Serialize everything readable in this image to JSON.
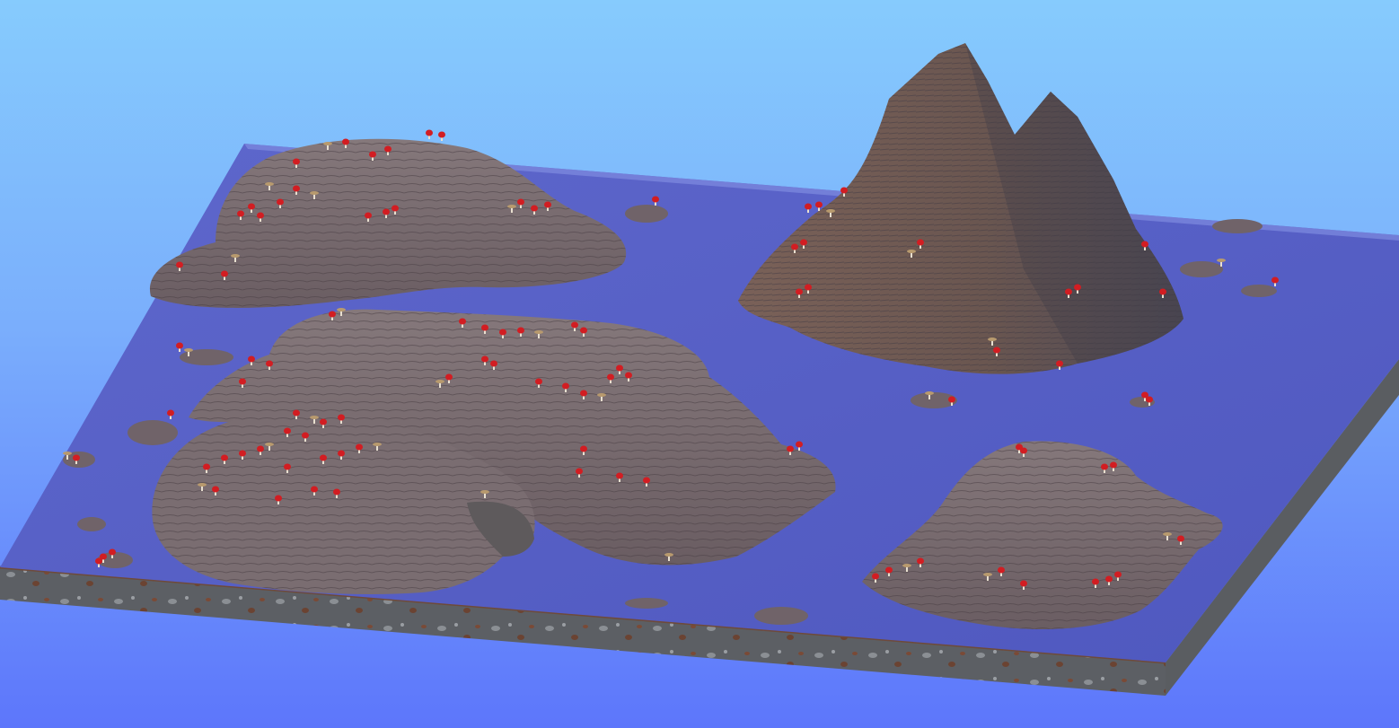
{
  "scene": {
    "kind": "voxel-world-render",
    "view": "isometric overview of a square voxel terrain slab",
    "colors": {
      "sky_top": "#86cbfd",
      "sky_bottom": "#5d76fb",
      "water": "#5a62c6",
      "water_edge": "#4a55b8",
      "land": "#7b6e72",
      "land_dark": "#5f5257",
      "mountain": "#6e5a55",
      "mountain_shadow": "#4f4a52",
      "slab_side": "#5b5f63",
      "slab_dirt": "#6a4a3a",
      "mushroom_red": "#d21d22",
      "mushroom_brown": "#b89a6e",
      "stem": "#e9e0d0"
    },
    "features": {
      "islands": 4,
      "mountain_peaks": 2,
      "mushroom_types": [
        "red-mushroom",
        "brown-mushroom"
      ]
    }
  }
}
